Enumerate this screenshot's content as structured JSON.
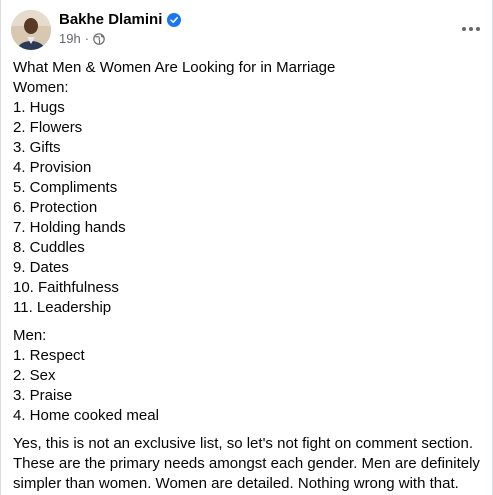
{
  "post": {
    "author": "Bakhe Dlamini",
    "time": "19h",
    "separator": "·",
    "audience_icon": "globe-icon",
    "verified_icon": "verified-badge-icon",
    "more_icon": "more-options-icon"
  },
  "content": {
    "title": "What Men & Women Are Looking for in Marriage",
    "women_heading": "Women:",
    "women_items": [
      "1. Hugs",
      "2. Flowers",
      "3. Gifts",
      "4. Provision",
      "5. Compliments",
      "6. Protection",
      "7. Holding hands",
      "8. Cuddles",
      "9. Dates",
      "10. Faithfulness",
      "11. Leadership"
    ],
    "men_heading": "Men:",
    "men_items": [
      "1. Respect",
      "2. Sex",
      "3. Praise",
      "4. Home cooked meal"
    ],
    "closing": "Yes, this is not an exclusive list, so let's not fight on comment section. These are the primary needs amongst each gender. Men are definitely simpler than women. Women are detailed. Nothing wrong with that."
  },
  "colors": {
    "verified": "#1877f2",
    "meta": "#65676b",
    "text": "#050505"
  }
}
